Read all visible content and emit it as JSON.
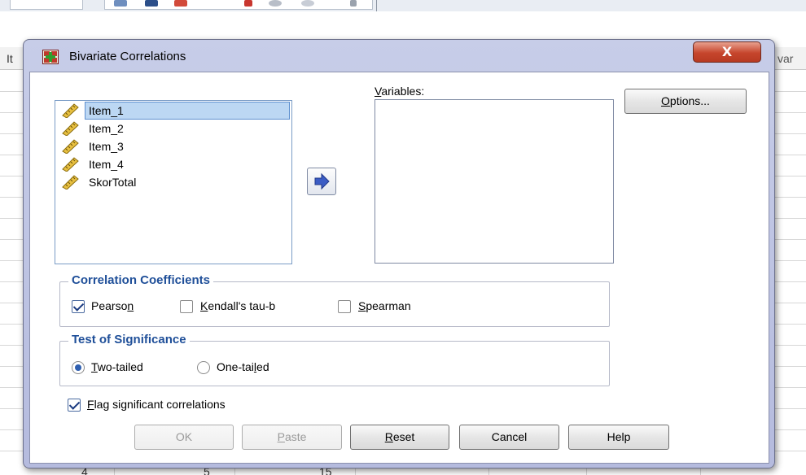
{
  "background": {
    "header_left": "It",
    "header_right": "var",
    "bottom_values": [
      "4",
      "5",
      "15"
    ]
  },
  "dialog": {
    "title": "Bivariate Correlations",
    "close_label": "X",
    "source_variables": [
      {
        "label": "Item_1",
        "selected": true
      },
      {
        "label": "Item_2",
        "selected": false
      },
      {
        "label": "Item_3",
        "selected": false
      },
      {
        "label": "Item_4",
        "selected": false
      },
      {
        "label": "SkorTotal",
        "selected": false
      }
    ],
    "variables_label_prefix": "V",
    "variables_label_rest": "ariables:",
    "options_button": {
      "u": "O",
      "rest": "ptions..."
    },
    "correlation_coefficients": {
      "title": "Correlation Coefficients",
      "pearson": {
        "label": "Pearso",
        "u": "n",
        "checked": true
      },
      "kendall": {
        "u": "K",
        "rest": "endall's tau-b",
        "checked": false
      },
      "spearman": {
        "u": "S",
        "rest": "pearman",
        "checked": false
      }
    },
    "test_of_significance": {
      "title": "Test of Significance",
      "two_tailed": {
        "u": "T",
        "rest": "wo-tailed",
        "selected": true
      },
      "one_tailed": {
        "label": "One-tai",
        "u": "l",
        "rest": "ed",
        "selected": false
      }
    },
    "flag_significant": {
      "u": "F",
      "rest": "lag significant correlations",
      "checked": true
    },
    "buttons": {
      "ok": "OK",
      "paste": {
        "u": "P",
        "rest": "aste"
      },
      "reset": {
        "u": "R",
        "rest": "eset"
      },
      "cancel": "Cancel",
      "help": "Help"
    }
  }
}
